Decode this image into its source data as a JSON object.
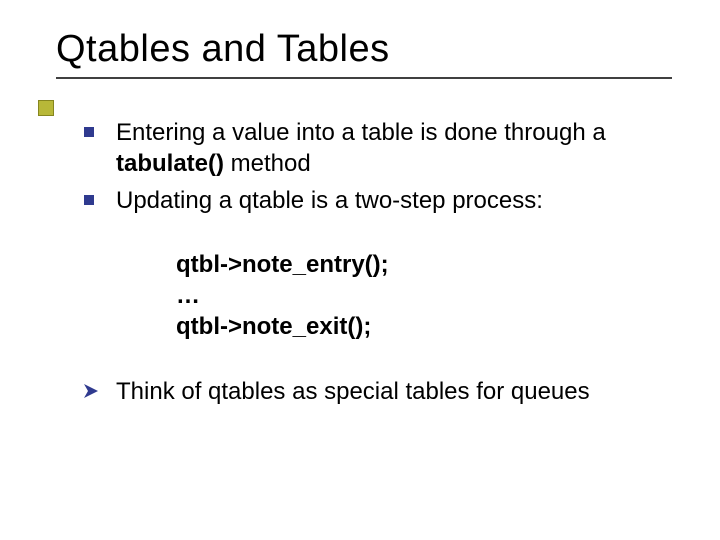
{
  "title": "Qtables and Tables",
  "bullets": {
    "b1_pre": "Entering a value into a table is done through a ",
    "b1_bold": "tabulate()",
    "b1_post": " method",
    "b2": "Updating a qtable is a two-step process:",
    "b3": "Think of qtables as special tables for queues"
  },
  "code": {
    "l1": "qtbl->note_entry();",
    "l2": "…",
    "l3": "qtbl->note_exit();"
  }
}
